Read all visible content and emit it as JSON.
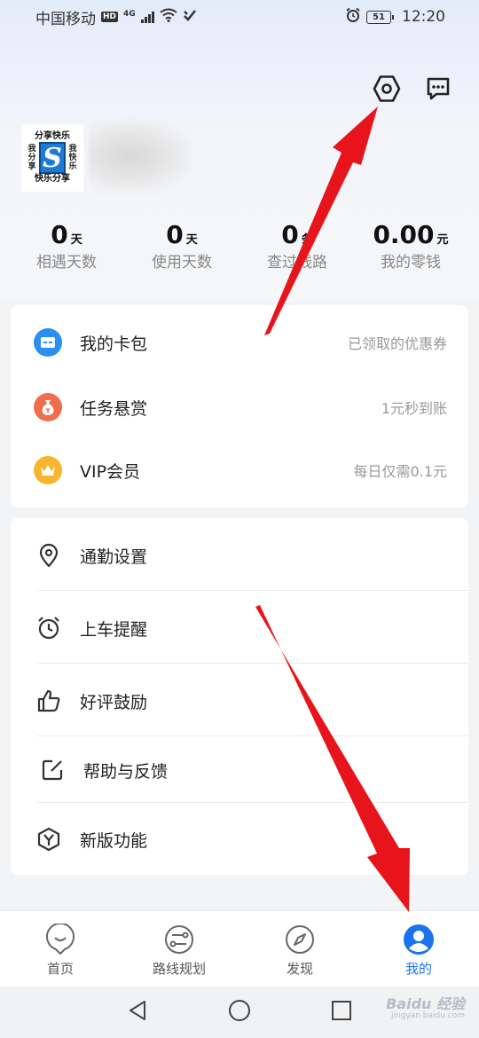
{
  "status_bar": {
    "carrier": "中国移动",
    "hd_badge": "HD",
    "network": "4G",
    "battery": "51",
    "time": "12:20",
    "icons": [
      "signal-icon",
      "wifi-icon",
      "alarm-icon",
      "battery-icon"
    ]
  },
  "header": {
    "icons": [
      "settings-icon",
      "message-icon"
    ]
  },
  "profile": {
    "avatar": {
      "top": "分享快乐",
      "left": "我分享",
      "right": "我快乐",
      "bottom": "快乐分享",
      "logo": "S"
    }
  },
  "stats": [
    {
      "value": "0",
      "unit": "天",
      "label": "相遇天数"
    },
    {
      "value": "0",
      "unit": "天",
      "label": "使用天数"
    },
    {
      "value": "0",
      "unit": "条",
      "label": "查过线路"
    },
    {
      "value": "0.00",
      "unit": "元",
      "label": "我的零钱"
    }
  ],
  "card1": [
    {
      "icon": "card-wallet-icon",
      "label": "我的卡包",
      "hint": "已领取的优惠券",
      "color": "#2b8ff0"
    },
    {
      "icon": "money-bag-icon",
      "label": "任务悬赏",
      "hint": "1元秒到账",
      "color": "#ef6f4b"
    },
    {
      "icon": "crown-icon",
      "label": "VIP会员",
      "hint": "每日仅需0.1元",
      "color": "#f6b62e"
    }
  ],
  "card2": [
    {
      "icon": "location-pin-icon",
      "label": "通勤设置"
    },
    {
      "icon": "alarm-clock-icon",
      "label": "上车提醒"
    },
    {
      "icon": "thumbs-up-icon",
      "label": "好评鼓励"
    },
    {
      "icon": "edit-icon",
      "label": "帮助与反馈"
    },
    {
      "icon": "new-feature-icon",
      "label": "新版功能"
    }
  ],
  "bottom_nav": [
    {
      "icon": "home-icon",
      "label": "首页",
      "active": false
    },
    {
      "icon": "route-icon",
      "label": "路线规划",
      "active": false
    },
    {
      "icon": "compass-icon",
      "label": "发现",
      "active": false
    },
    {
      "icon": "profile-icon",
      "label": "我的",
      "active": true
    }
  ],
  "colors": {
    "accent": "#1a73e8",
    "arrow": "#e8141b"
  },
  "watermark": {
    "main": "Baidu 经验",
    "sub": "jingyan.baidu.com"
  }
}
